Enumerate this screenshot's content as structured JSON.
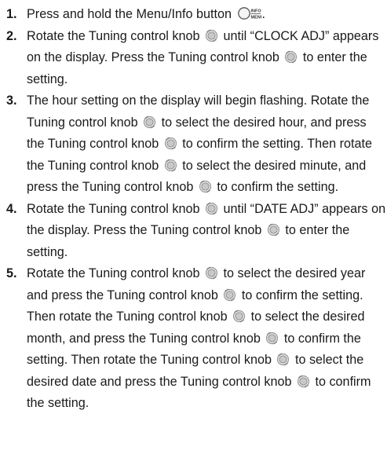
{
  "steps": [
    {
      "number": "1.",
      "segments": [
        {
          "t": "text",
          "v": "Press and hold the Menu/Info button "
        },
        {
          "t": "icon",
          "name": "menu-info-button-icon",
          "label": "INFO · MENU"
        },
        {
          "t": "text",
          "v": "."
        }
      ]
    },
    {
      "number": "2.",
      "segments": [
        {
          "t": "text",
          "v": "Rotate the Tuning control knob "
        },
        {
          "t": "icon",
          "name": "tuning-knob-icon"
        },
        {
          "t": "text",
          "v": " until “CLOCK ADJ” appears on the display. Press the Tuning control knob "
        },
        {
          "t": "icon",
          "name": "tuning-knob-icon"
        },
        {
          "t": "text",
          "v": " to enter the setting."
        }
      ]
    },
    {
      "number": "3.",
      "segments": [
        {
          "t": "text",
          "v": "The hour setting on the display will begin flashing. Rotate the Tuning control knob "
        },
        {
          "t": "icon",
          "name": "tuning-knob-icon"
        },
        {
          "t": "text",
          "v": " to select the desired hour, and press the Tuning control knob "
        },
        {
          "t": "icon",
          "name": "tuning-knob-icon"
        },
        {
          "t": "text",
          "v": " to confirm the setting. Then rotate the Tuning control knob "
        },
        {
          "t": "icon",
          "name": "tuning-knob-icon"
        },
        {
          "t": "text",
          "v": " to select the desired minute, and press the Tuning control knob "
        },
        {
          "t": "icon",
          "name": "tuning-knob-icon"
        },
        {
          "t": "text",
          "v": " to confirm the setting."
        }
      ]
    },
    {
      "number": "4.",
      "segments": [
        {
          "t": "text",
          "v": "Rotate the Tuning control knob "
        },
        {
          "t": "icon",
          "name": "tuning-knob-icon"
        },
        {
          "t": "text",
          "v": " until “DATE ADJ” appears on the display. Press the Tuning control knob "
        },
        {
          "t": "icon",
          "name": "tuning-knob-icon"
        },
        {
          "t": "text",
          "v": " to enter the setting."
        }
      ]
    },
    {
      "number": "5.",
      "segments": [
        {
          "t": "text",
          "v": "Rotate the Tuning control knob "
        },
        {
          "t": "icon",
          "name": "tuning-knob-icon"
        },
        {
          "t": "text",
          "v": " to select the desired year and press the Tuning control knob "
        },
        {
          "t": "icon",
          "name": "tuning-knob-icon"
        },
        {
          "t": "text",
          "v": " to confirm the setting. Then rotate the Tuning control knob "
        },
        {
          "t": "icon",
          "name": "tuning-knob-icon"
        },
        {
          "t": "text",
          "v": " to select the desired month, and press the Tuning control knob "
        },
        {
          "t": "icon",
          "name": "tuning-knob-icon"
        },
        {
          "t": "text",
          "v": " to confirm the setting. Then rotate the Tuning control knob "
        },
        {
          "t": "icon",
          "name": "tuning-knob-icon"
        },
        {
          "t": "text",
          "v": " to select the desired date and press the Tuning control knob "
        },
        {
          "t": "icon",
          "name": "tuning-knob-icon"
        },
        {
          "t": "text",
          "v": " to confirm the setting."
        }
      ]
    }
  ]
}
